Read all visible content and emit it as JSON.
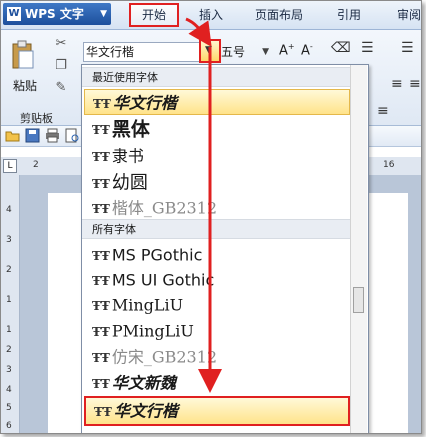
{
  "app": {
    "name": "WPS 文字"
  },
  "ribbon_tabs": [
    {
      "label": "开始"
    },
    {
      "label": "插入"
    },
    {
      "label": "页面布局"
    },
    {
      "label": "引用"
    },
    {
      "label": "审阅"
    }
  ],
  "clipboard": {
    "paste_label": "粘贴",
    "group_label": "剪贴板"
  },
  "font": {
    "current": "华文行楷",
    "size": "五号"
  },
  "ruler": {
    "top_numbers": [
      "2",
      "16"
    ],
    "left_numbers": [
      "4",
      "3",
      "2",
      "1",
      "1",
      "2",
      "3",
      "4",
      "5",
      "6"
    ]
  },
  "dropdown": {
    "recent_header": "最近使用字体",
    "all_header": "所有字体",
    "recent_fonts": [
      "华文行楷",
      "黑体",
      "隶书",
      "幼圆",
      "楷体_GB2312"
    ],
    "all_fonts": [
      "MS PGothic",
      "MS UI Gothic",
      "MingLiU",
      "PMingLiU",
      "仿宋_GB2312",
      "华文新魏",
      "华文行楷"
    ],
    "font_icon": "truetype-icon"
  },
  "colors": {
    "annotation": "#e02020",
    "selection": "#ffe38a"
  }
}
